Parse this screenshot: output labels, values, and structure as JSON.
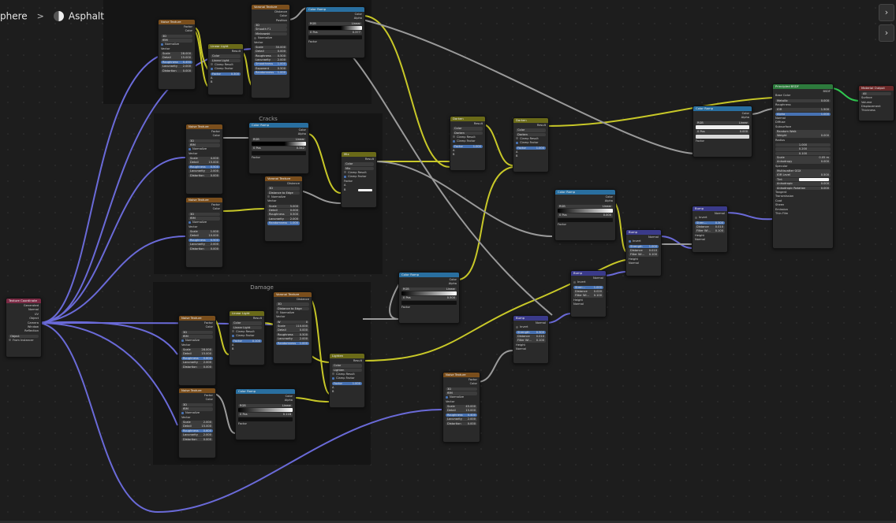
{
  "breadcrumb": {
    "object": "phere",
    "separator": ">",
    "material": "Asphalt"
  },
  "frames": {
    "top": "",
    "cracks": "Cracks",
    "damage": "Damage"
  },
  "common": {
    "factor": "Factor",
    "color": "Color",
    "alpha": "Alpha",
    "result": "Result",
    "distance": "Distance",
    "position": "Position",
    "vector": "Vector",
    "normal": "Normal",
    "height": "Height",
    "normalize": "Normalize",
    "clamp_result": "Clamp Result",
    "clamp_factor": "Clamp Factor",
    "a": "A",
    "b": "B",
    "pos": "Pos",
    "rgb": "RGB",
    "linear": "Linear"
  },
  "noise_top": {
    "title": "Noise Texture",
    "dim": "3D",
    "type": "fBM",
    "scale": "28.000",
    "detail": "15.000",
    "roughness": "0.450",
    "lacunarity": "2.000",
    "distortion": "0.000"
  },
  "voronoi_top": {
    "title": "Voronoi Texture",
    "dim": "3D",
    "feature": "Smooth F1",
    "metric": "Minkowski",
    "scale": "30.000",
    "detail": "0.000",
    "roughness": "0.500",
    "lacunarity": "2.000",
    "smoothness": "1.000",
    "exponent": "0.500",
    "randomness": "1.000"
  },
  "linear_light_top": {
    "title": "Linear Light",
    "mode": "Linear Light",
    "factor": "0.300"
  },
  "ramp_top": {
    "title": "Color Ramp",
    "idx": "0",
    "pos": "0.377"
  },
  "noise_cr1": {
    "title": "Noise Texture",
    "dim": "3D",
    "type": "fBM",
    "scale": "4.000",
    "detail": "15.000",
    "roughness": "0.500",
    "lacunarity": "2.000",
    "distortion": "0.000"
  },
  "noise_cr2": {
    "title": "Noise Texture",
    "dim": "3D",
    "type": "fBM",
    "scale": "1.000",
    "detail": "10.000",
    "roughness": "0.500",
    "lacunarity": "2.000",
    "distortion": "0.000"
  },
  "ramp_cr": {
    "title": "Color Ramp",
    "idx": "0",
    "pos": "0.342"
  },
  "voronoi_cr": {
    "title": "Voronoi Texture",
    "dim": "3D",
    "feature": "Distance to Edge",
    "scale": "5.000",
    "detail": "0.000",
    "roughness": "0.500",
    "lacunarity": "2.000",
    "randomness": "1.000"
  },
  "mix_cr": {
    "title": "Mix",
    "mode": "Mix"
  },
  "texcoord": {
    "title": "Texture Coordinate",
    "outputs": [
      "Generated",
      "Normal",
      "UV",
      "Object",
      "Camera",
      "Window",
      "Reflection"
    ],
    "object_label": "Object",
    "from_instancer": "From Instancer"
  },
  "noise_dm1": {
    "title": "Noise Texture",
    "dim": "3D",
    "type": "fBM",
    "scale": "28.000",
    "detail": "15.000",
    "roughness": "0.600",
    "lacunarity": "2.000",
    "distortion": "0.000"
  },
  "noise_dm2": {
    "title": "Noise Texture",
    "dim": "3D",
    "type": "fBM",
    "scale": "2.000",
    "detail": "15.000",
    "roughness": "0.600",
    "lacunarity": "2.000",
    "distortion": "0.000"
  },
  "linear_light_dm": {
    "title": "Linear Light",
    "mode": "Linear Light",
    "factor": "0.100"
  },
  "voronoi_dm": {
    "title": "Voronoi Texture",
    "dim": "3D",
    "feature": "Distance to Edge",
    "w": "0",
    "scale": "110.000",
    "detail": "0.000",
    "roughness": "0.500",
    "lacunarity": "2.000",
    "randomness": "1.000"
  },
  "ramp_dm": {
    "title": "Color Ramp",
    "idx": "0",
    "pos": "0.118"
  },
  "lighten": {
    "title": "Lighten",
    "mode": "Lighten",
    "factor": "1.000"
  },
  "darken1": {
    "title": "Darken",
    "mode": "Darken",
    "factor": "1.000"
  },
  "darken2": {
    "title": "Darken",
    "mode": "Darken",
    "factor": "1.000"
  },
  "ramp_mid": {
    "title": "Color Ramp",
    "idx": "0",
    "pos": "0.500"
  },
  "ramp_mid2": {
    "title": "Color Ramp",
    "idx": "0",
    "pos": "0.000"
  },
  "ramp_right": {
    "title": "Color Ramp",
    "idx": "0",
    "pos": "0.000"
  },
  "bump_a": {
    "title": "Bump",
    "invert": "Invert",
    "strength": "0.300",
    "distance": "0.010",
    "filter": "0.100"
  },
  "bump_b": {
    "title": "Bump",
    "invert": "Invert",
    "strength": "1.000",
    "distance": "0.020",
    "filter": "0.100"
  },
  "bump_c": {
    "title": "Bump",
    "invert": "Invert",
    "strength": "1.000",
    "distance": "0.010",
    "filter": "0.100"
  },
  "bump_d": {
    "title": "Bump",
    "invert": "Invert",
    "strength": "0.300",
    "distance": "0.010",
    "filter": "0.100"
  },
  "noise_bottom": {
    "title": "Noise Texture",
    "dim": "3D",
    "type": "fBM",
    "scale": "45.000",
    "detail": "15.000",
    "roughness": "0.400",
    "lacunarity": "2.000",
    "distortion": "0.000"
  },
  "bsdf": {
    "title": "Principled BSDF",
    "out": "BSDF",
    "base_color": "Base Color",
    "metallic": "Metallic",
    "metallic_v": "0.000",
    "roughness": "Roughness",
    "ior": "IOR",
    "ior_v": "1.500",
    "alpha": "Alpha",
    "alpha_v": "1.000",
    "normal": "Normal",
    "diffuse": "Diffuse",
    "subsurface": "Subsurface",
    "method": "Random Walk",
    "weight": "Weight",
    "weight_v": "0.000",
    "radius": "Radius",
    "r1": "1.000",
    "r2": "0.200",
    "r3": "0.100",
    "scale": "Scale",
    "scale_v": "0.05 m",
    "aniso": "Anisotropy",
    "aniso_v": "0.000",
    "specular": "Specular",
    "distribution": "Multiscatter GGX",
    "ior_level": "IOR Level",
    "ior_level_v": "0.500",
    "tint": "Tint",
    "anisotropic": "Anisotropic",
    "anisotropic_v": "0.000",
    "aniso_rot": "Anisotropic Rotation",
    "aniso_rot_v": "0.000",
    "tangent": "Tangent",
    "sections": [
      "Transmission",
      "Coat",
      "Sheen",
      "Emission",
      "Thin Film"
    ]
  },
  "output": {
    "title": "Material Output",
    "target": "All",
    "surface": "Surface",
    "volume": "Volume",
    "displacement": "Displacement",
    "thickness": "Thickness"
  },
  "colors": {
    "tex": "#7a4e1c",
    "conv": "#296fa0",
    "color": "#6a6a18",
    "vector": "#3a3a8a",
    "shader": "#2d7a3c",
    "link_yellow": "#c8c828",
    "link_grey": "#9a9a9a",
    "link_purple": "#6a6ad8",
    "link_green": "#30c850"
  }
}
